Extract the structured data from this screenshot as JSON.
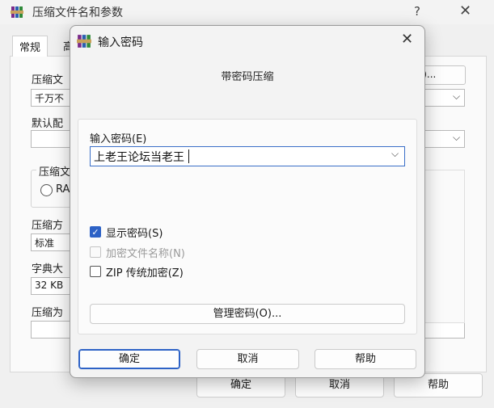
{
  "background_window": {
    "title": "压缩文件名和参数",
    "help_glyph": "?",
    "close_glyph": "✕",
    "tabs": [
      "常规",
      "高"
    ],
    "archive_name_label": "压缩文",
    "archive_name_value": "千万不",
    "browse_label": "B)...",
    "default_profile_label": "默认配",
    "archive_format_label": "压缩文",
    "format_option": "RA",
    "method_label": "压缩方",
    "method_value": "标准",
    "dict_label": "字典大",
    "dict_value": "32 KB",
    "split_label": "压缩为",
    "ok_label": "确定",
    "cancel_label": "取消",
    "help_label": "帮助"
  },
  "dialog": {
    "title": "输入密码",
    "close_glyph": "✕",
    "subtitle": "带密码压缩",
    "password_label": "输入密码(E)",
    "password_value": "上老王论坛当老王",
    "dropdown_glyph": "⌵",
    "show_password_label": "显示密码(S)",
    "show_password_checked": true,
    "encrypt_names_label": "加密文件名称(N)",
    "encrypt_names_checked": false,
    "encrypt_names_enabled": false,
    "zip_legacy_label": "ZIP 传统加密(Z)",
    "zip_legacy_checked": false,
    "manage_button_label": "管理密码(O)...",
    "ok_label": "确定",
    "cancel_label": "取消",
    "help_label": "帮助"
  },
  "colors": {
    "accent": "#2d62c6",
    "window_bg": "#f0f0f0",
    "dialog_bg": "#f3f3f3"
  },
  "icons": {
    "app_logo": "winrar-books-icon",
    "check": "checkmark-icon"
  }
}
